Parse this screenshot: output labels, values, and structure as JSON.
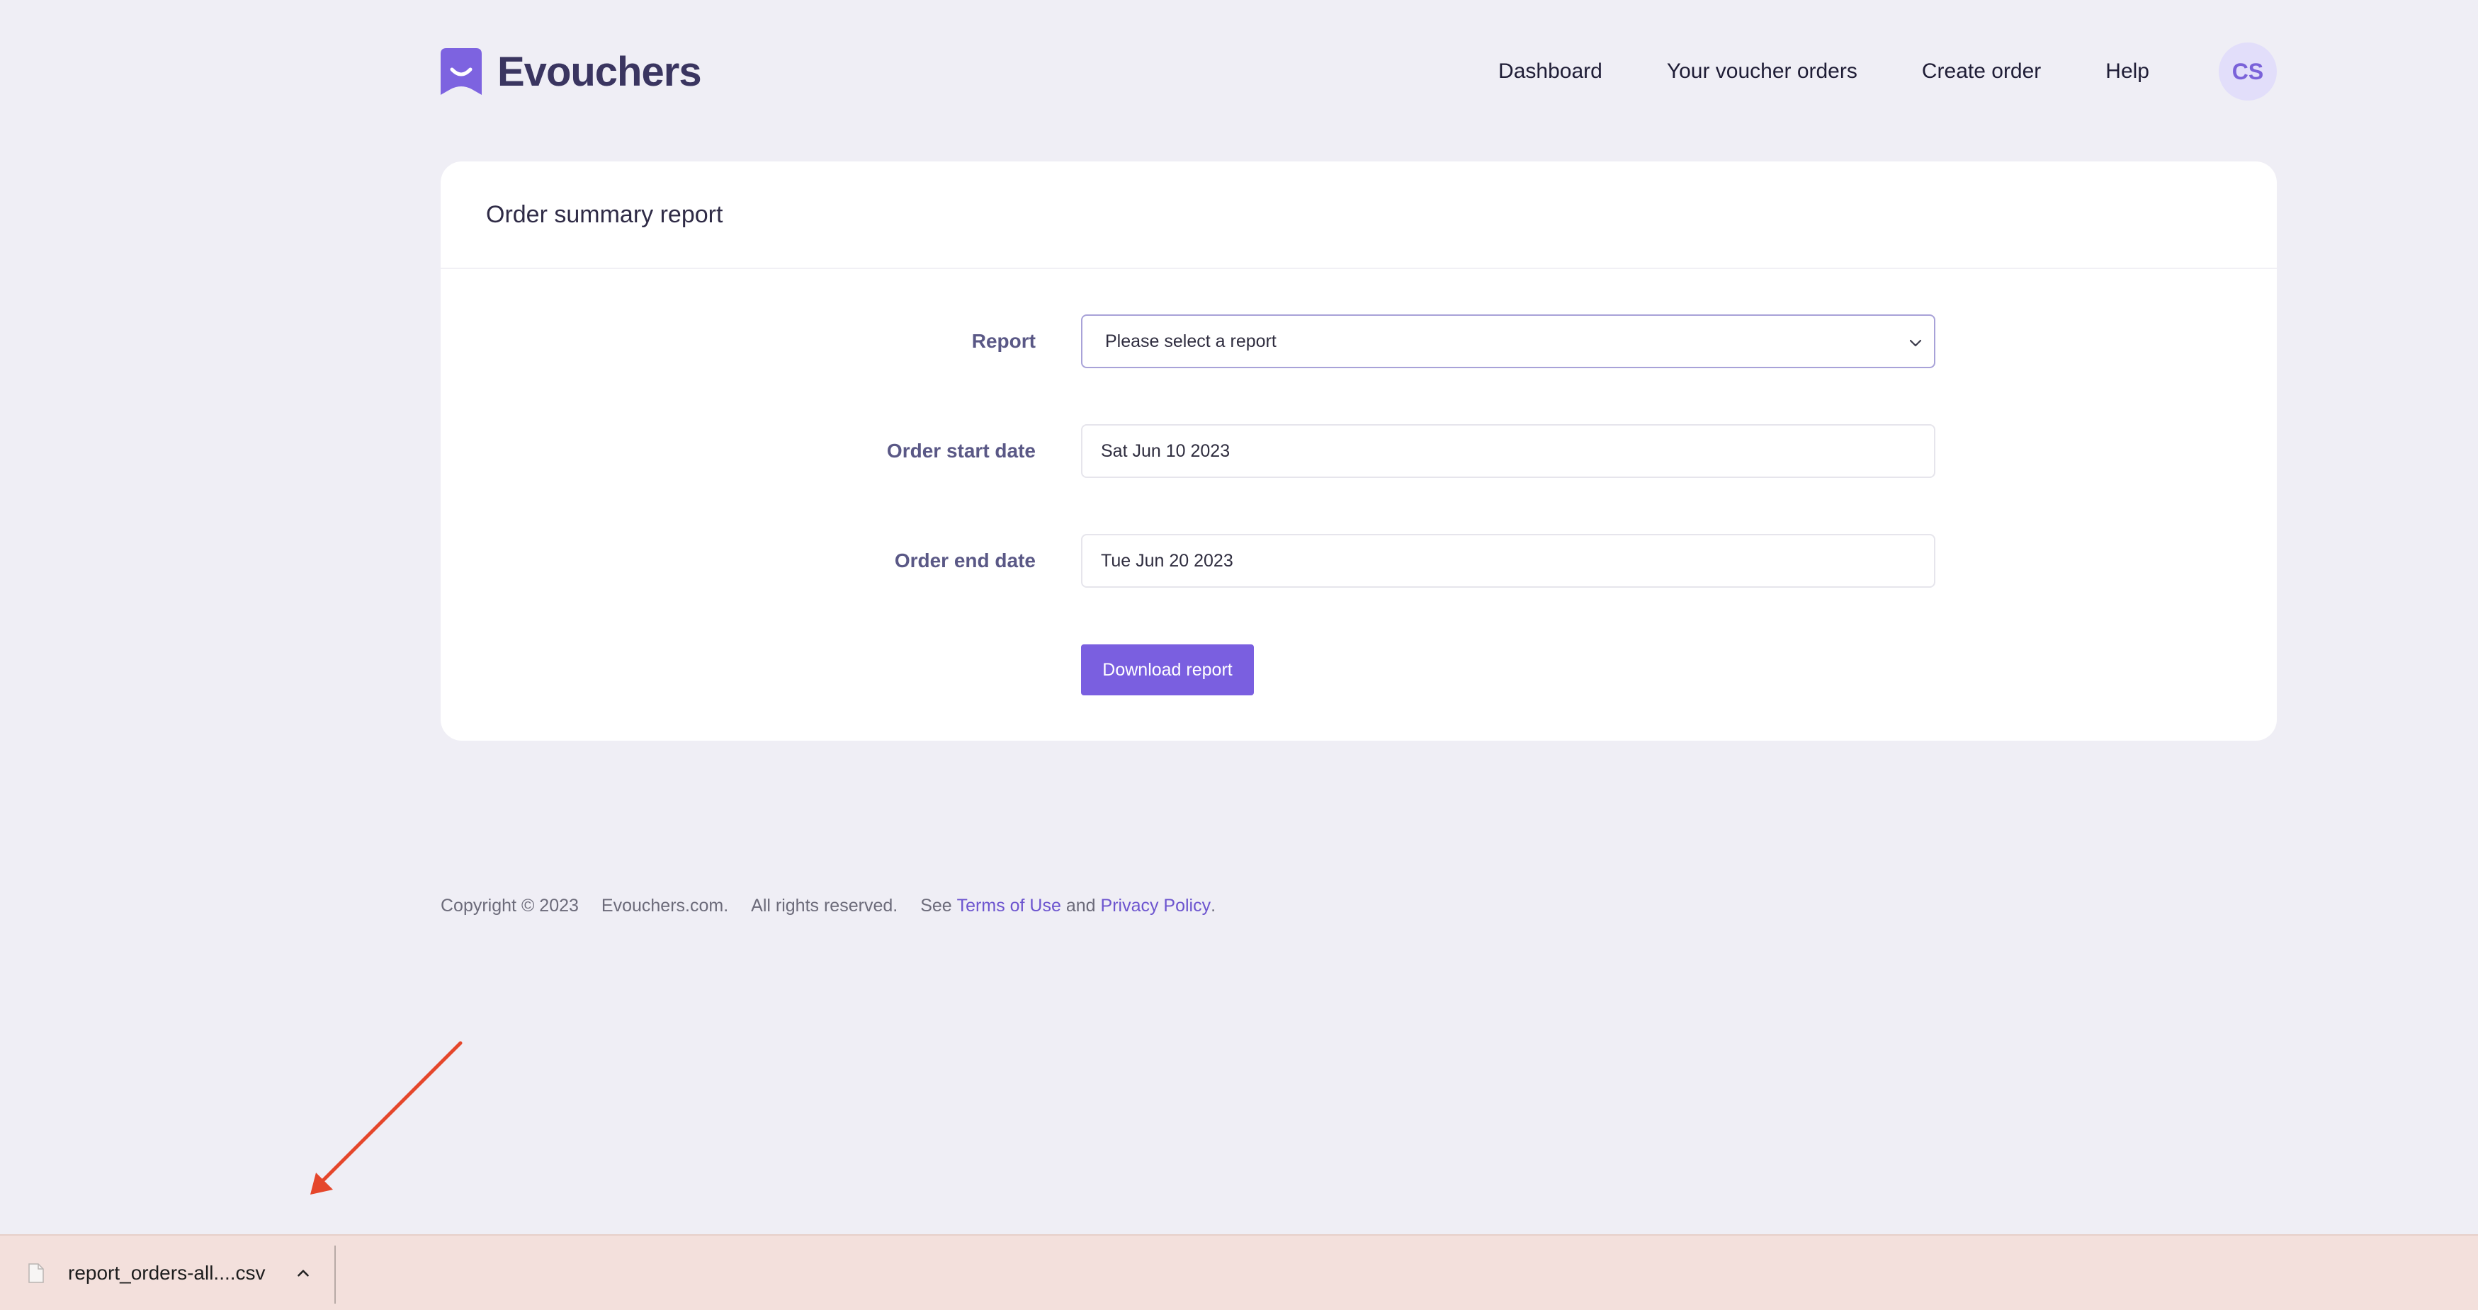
{
  "brand": {
    "name": "Evouchers",
    "logo_icon": "evouchers-logo-icon",
    "accent": "#7a5fe0"
  },
  "nav": {
    "items": [
      "Dashboard",
      "Your voucher orders",
      "Create order",
      "Help"
    ],
    "avatar_initials": "CS"
  },
  "card": {
    "title": "Order summary report",
    "fields": {
      "report": {
        "label": "Report",
        "value": "Please select a report"
      },
      "start_date": {
        "label": "Order start date",
        "value": "Sat Jun 10 2023"
      },
      "end_date": {
        "label": "Order end date",
        "value": "Tue Jun 20 2023"
      }
    },
    "download_button": "Download report"
  },
  "footer": {
    "copyright": "Copyright © 2023",
    "site": "Evouchers.com.",
    "rights": "All rights reserved.",
    "see": "See ",
    "terms": "Terms of Use",
    "and": " and ",
    "privacy": "Privacy Policy",
    "period": "."
  },
  "download_bar": {
    "file_name": "report_orders-all....csv",
    "background": "#f3e0dc"
  },
  "annotation": {
    "color": "#e5462b",
    "icon": "red-arrow-icon"
  }
}
